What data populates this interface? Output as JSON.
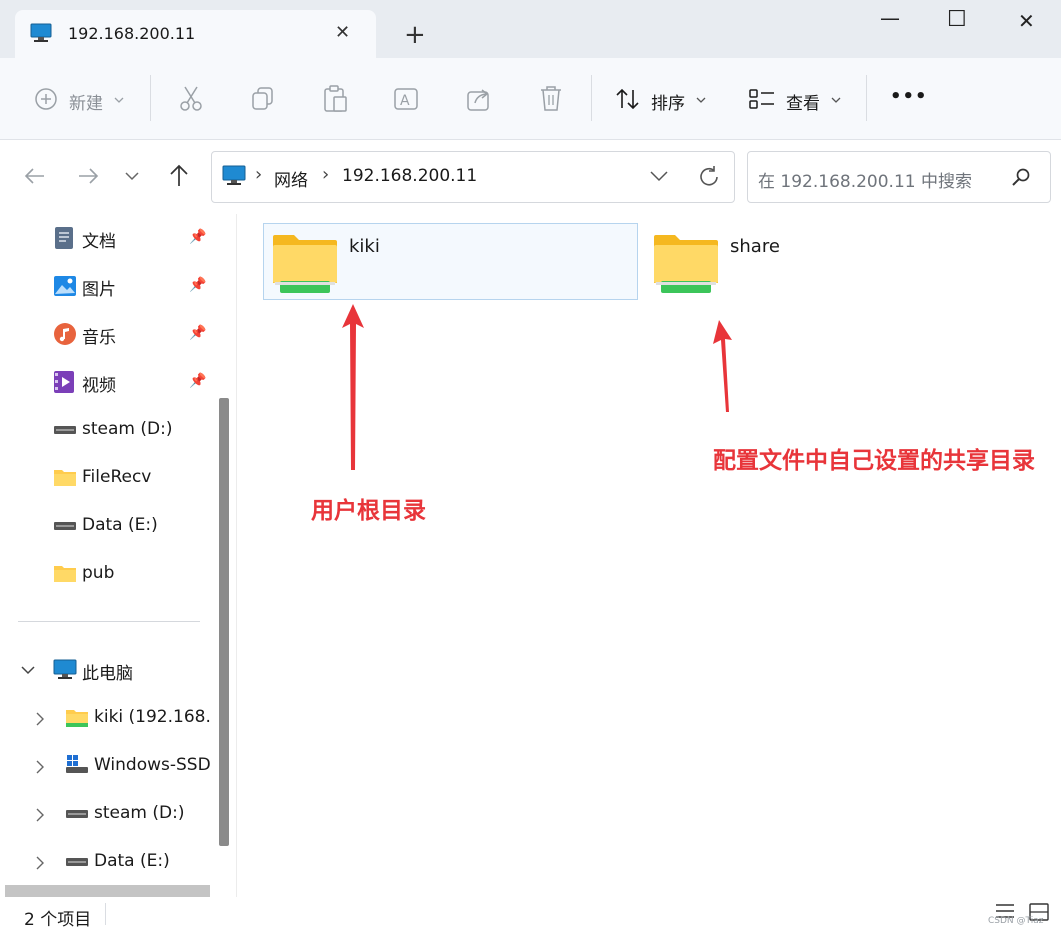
{
  "tab": {
    "title": "192.168.200.11",
    "close": "✕",
    "new_tab": "+"
  },
  "window": {
    "minimize": "—",
    "maximize": "☐",
    "close": "✕"
  },
  "toolbar": {
    "new_label": "新建",
    "sort_label": "排序",
    "view_label": "查看",
    "more": "•••"
  },
  "address": {
    "separator": "›",
    "network": "网络",
    "host": "192.168.200.11"
  },
  "search": {
    "placeholder": "在 192.168.200.11 中搜索"
  },
  "sidebar": {
    "quick": [
      {
        "label": "文档",
        "pinned": true
      },
      {
        "label": "图片",
        "pinned": true
      },
      {
        "label": "音乐",
        "pinned": true
      },
      {
        "label": "视频",
        "pinned": true
      },
      {
        "label": "steam (D:)"
      },
      {
        "label": "FileRecv"
      },
      {
        "label": "Data (E:)"
      },
      {
        "label": "pub"
      }
    ],
    "this_pc": "此电脑",
    "pc_items": [
      {
        "label": "kiki (192.168."
      },
      {
        "label": "Windows-SSD"
      },
      {
        "label": "steam (D:)"
      },
      {
        "label": "Data (E:)"
      }
    ]
  },
  "content": {
    "folders": [
      {
        "name": "kiki",
        "selected": true
      },
      {
        "name": "share",
        "selected": false
      }
    ],
    "annotations": {
      "kiki": "用户根目录",
      "share": "配置文件中自己设置的共享目录"
    }
  },
  "status": {
    "count": "2 个项目"
  },
  "watermark": "CSDN @Tiaz",
  "colors": {
    "annotation": "#e8353a",
    "folder": "#ffd24d",
    "share_bar": "#3cc55a",
    "selection": "#b6d4ee"
  }
}
